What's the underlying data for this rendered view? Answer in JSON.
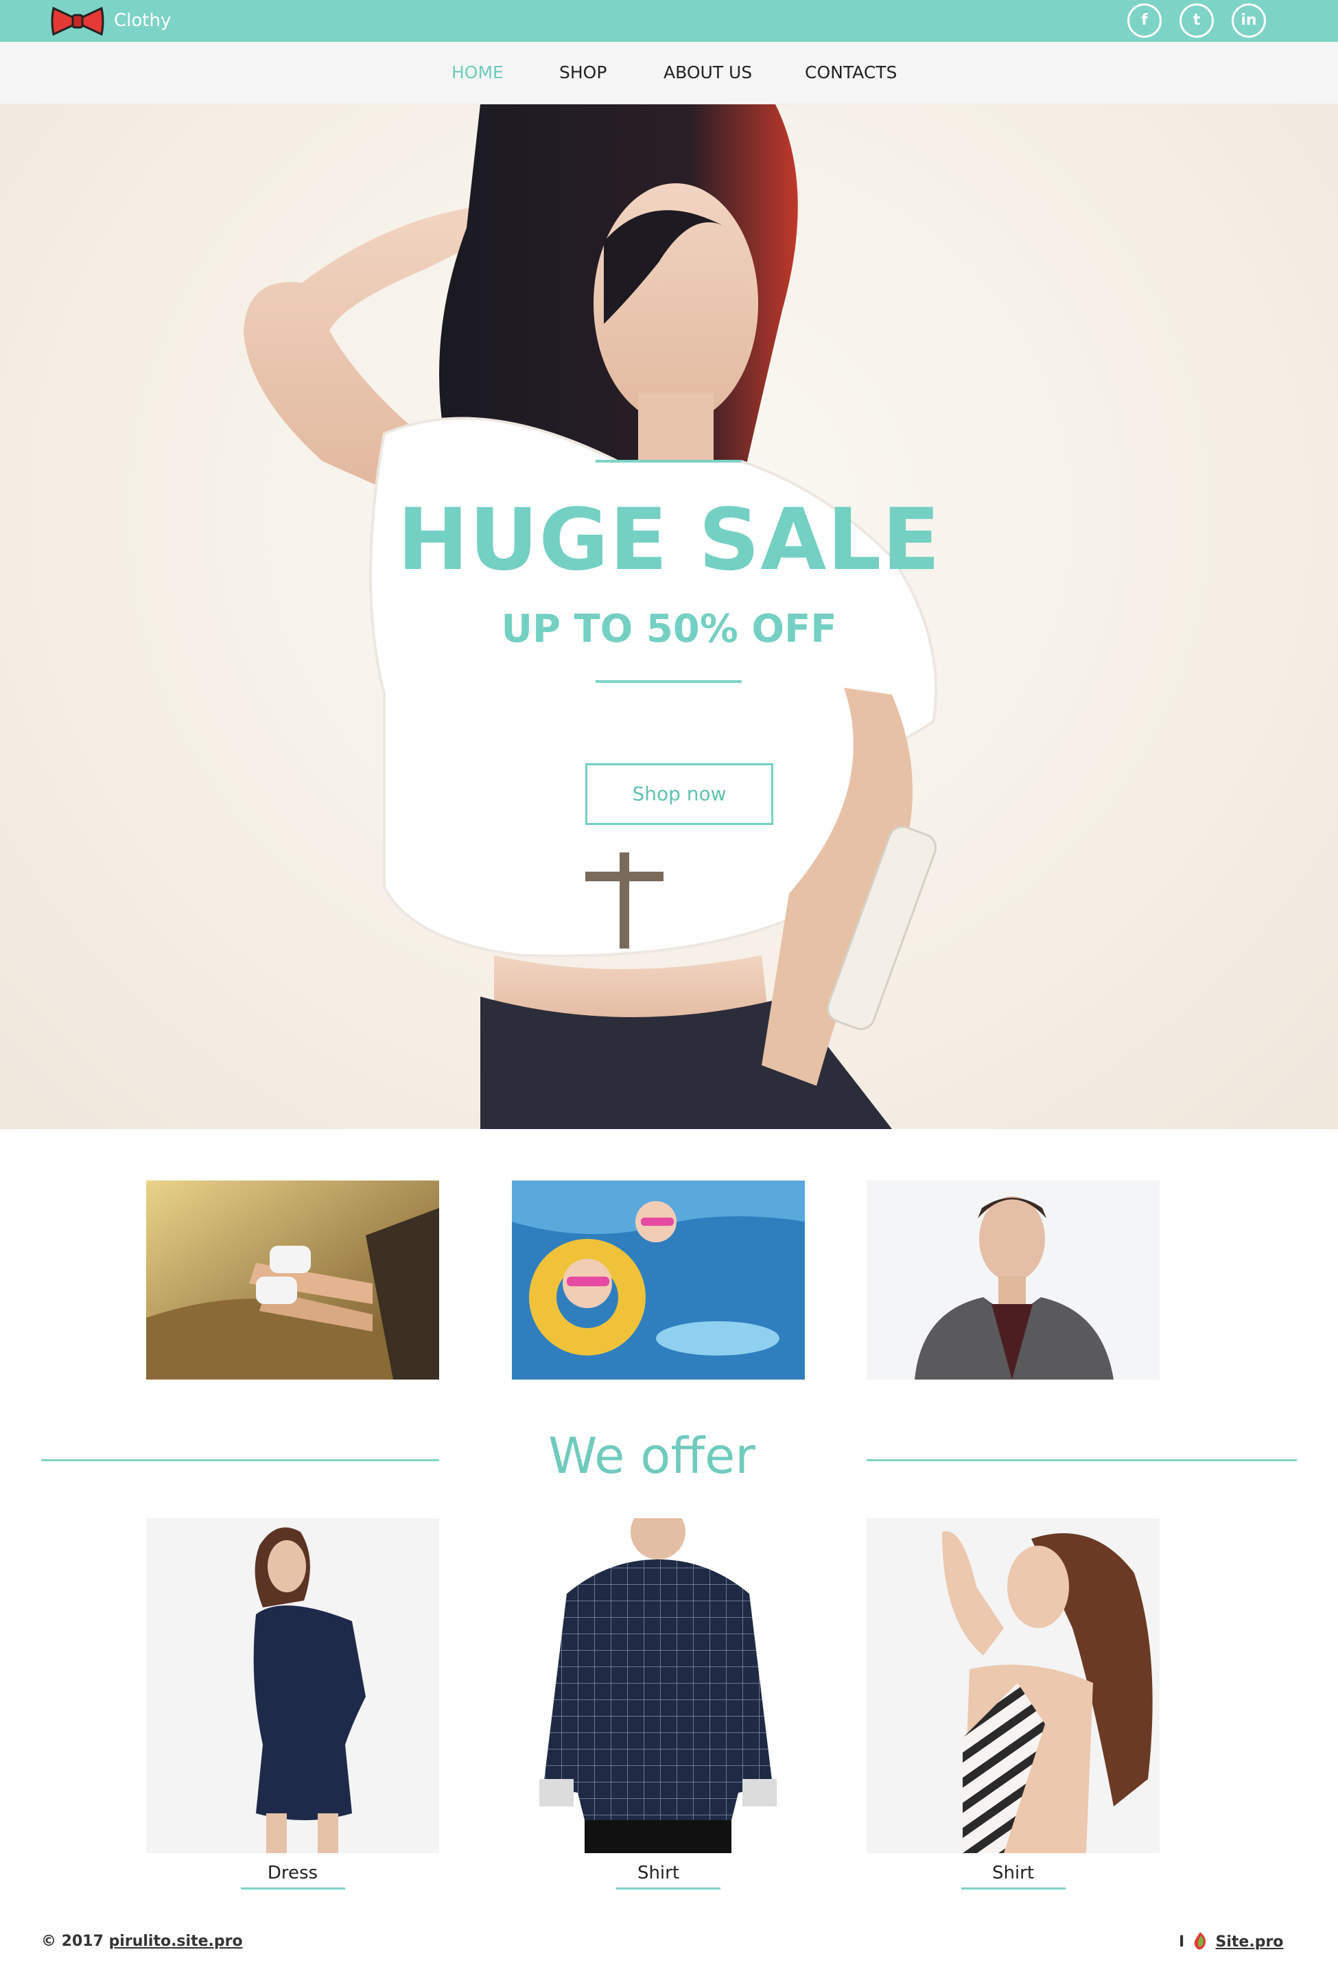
{
  "header": {
    "brand": "Clothy",
    "social": [
      {
        "icon": "facebook-icon",
        "glyph": "f"
      },
      {
        "icon": "twitter-icon",
        "glyph": "t"
      },
      {
        "icon": "linkedin-icon",
        "glyph": "in"
      }
    ]
  },
  "nav": {
    "items": [
      "HOME",
      "SHOP",
      "ABOUT US",
      "CONTACTS"
    ],
    "active_index": 0
  },
  "hero": {
    "title": "HUGE SALE",
    "subtitle": "UP TO 50% OFF",
    "button_label": "Shop now"
  },
  "gallery": {
    "items": [
      {
        "image": "sneakers-legs-photo"
      },
      {
        "image": "kids-swimming-photo"
      },
      {
        "image": "man-in-blazer-photo"
      }
    ]
  },
  "offer": {
    "title": "We offer",
    "products": [
      {
        "label": "Dress",
        "image": "navy-dress-photo"
      },
      {
        "label": "Shirt",
        "image": "checked-shirt-photo"
      },
      {
        "label": "Shirt",
        "image": "striped-top-photo"
      }
    ]
  },
  "footer": {
    "copyright": "© 2017",
    "site_link": "pirulito.site.pro",
    "made_prefix": "I",
    "made_link": "Site.pro"
  },
  "colors": {
    "accent": "#7dd3c6",
    "accent_text": "#74d0c2",
    "nav_bg": "#f6f6f6",
    "text": "#222222"
  }
}
